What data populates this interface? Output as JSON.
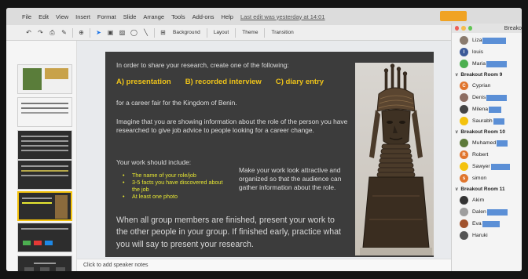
{
  "menubar": {
    "items": [
      "File",
      "Edit",
      "View",
      "Insert",
      "Format",
      "Slide",
      "Arrange",
      "Tools",
      "Add-ons",
      "Help"
    ],
    "last_edit": "Last edit was yesterday at 14:01"
  },
  "toolbar": {
    "background_label": "Background",
    "layout_label": "Layout",
    "theme_label": "Theme",
    "transition_label": "Transition"
  },
  "slide": {
    "intro": "In order to share your research, create one of the following:",
    "option_a": "A) presentation",
    "option_b": "B) recorded interview",
    "option_c": "C) diary entry",
    "career_fair": "for a career fair for the Kingdom of Benin.",
    "imagine": "Imagine that you are showing information about the role of the person you have researched to give job advice to people looking for a career change.",
    "include_heading": "Your work should include:",
    "bullets": [
      "The name of your role/job",
      "3-5 facts you have discovered about the job",
      "At least one photo"
    ],
    "attractive": "Make your work look attractive and organized so that the audience can gather information about the role.",
    "finished": "When all group members are finished, present your work to the other people in your group.  If finished early, practice what you will say to present your research."
  },
  "notes_placeholder": "Click to add speaker notes",
  "breakout": {
    "title": "Breako",
    "top_participants": [
      {
        "name": "Liza",
        "initial": "",
        "color": "#8a7b6e"
      },
      {
        "name": "louis",
        "initial": "l",
        "color": "#3b5998"
      },
      {
        "name": "Maria",
        "initial": "",
        "color": "#4caf50"
      }
    ],
    "rooms": [
      {
        "label": "Breakout Room 9",
        "participants": [
          {
            "name": "Cyprian",
            "initial": "C",
            "color": "#e0752d"
          },
          {
            "name": "Denis",
            "initial": "",
            "color": "#8d6e63"
          },
          {
            "name": "Milena",
            "initial": "",
            "color": "#444444"
          },
          {
            "name": "Saurabh",
            "initial": "",
            "color": "#f4c20d"
          }
        ]
      },
      {
        "label": "Breakout Room 10",
        "participants": [
          {
            "name": "Muhamed",
            "initial": "",
            "color": "#5d7a3a"
          },
          {
            "name": "Robert",
            "initial": "R",
            "color": "#e0752d"
          },
          {
            "name": "Sawyer",
            "initial": "",
            "color": "#f4c20d"
          },
          {
            "name": "simon",
            "initial": "s",
            "color": "#e0752d"
          }
        ]
      },
      {
        "label": "Breakout Room 11",
        "participants": [
          {
            "name": "Akim",
            "initial": "",
            "color": "#333333"
          },
          {
            "name": "Dalen",
            "initial": "",
            "color": "#9e9e9e"
          },
          {
            "name": "Eva",
            "initial": "",
            "color": "#a0522d"
          },
          {
            "name": "Haruki",
            "initial": "",
            "color": "#555555"
          }
        ]
      }
    ]
  },
  "colors": {
    "accent_yellow": "#f0c419",
    "bullet_yellow": "#e6e632",
    "redaction_blue": "#5b8fd6"
  }
}
